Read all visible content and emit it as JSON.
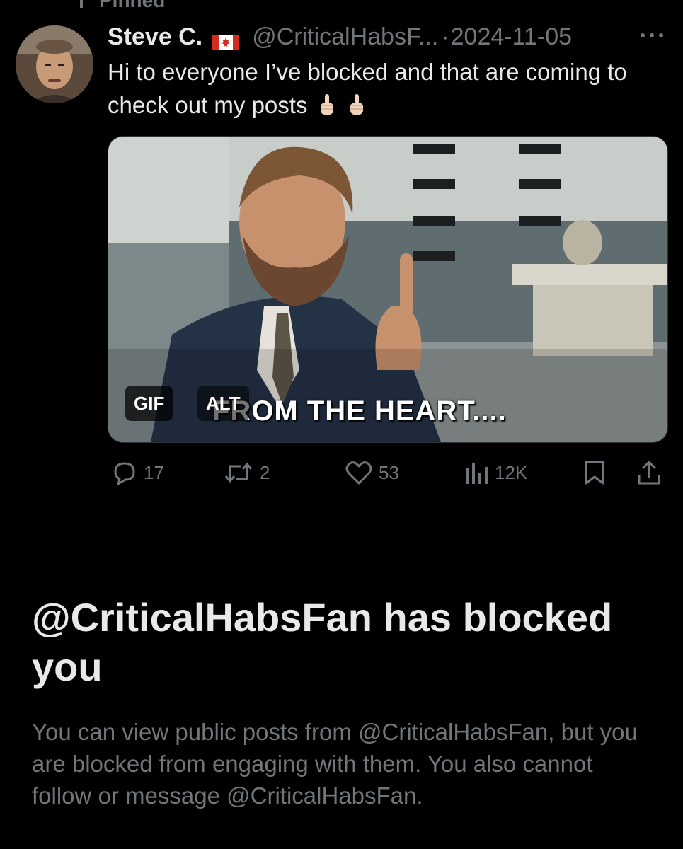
{
  "pinned": {
    "label": "Pinned"
  },
  "tweet": {
    "display_name": "Steve C.",
    "flag_icon": "canada-flag",
    "handle": "@CriticalHabsF...",
    "separator": "·",
    "date": "2024-11-05",
    "text": "Hi to everyone I’ve blocked and that are coming to check out my posts",
    "text_emojis": [
      "👆🏻",
      "👆🏻"
    ],
    "media": {
      "type": "GIF",
      "caption": "FROM THE HEART....",
      "gif_badge": "GIF",
      "alt_badge": "ALT"
    },
    "stats": {
      "replies": "17",
      "reposts": "2",
      "likes": "53",
      "views": "12K"
    },
    "icons": {
      "reply": "reply-icon",
      "repost": "repost-icon",
      "like": "heart-icon",
      "views": "views-icon",
      "bookmark": "bookmark-icon",
      "share": "share-icon",
      "more": "more-icon"
    }
  },
  "blocked_notice": {
    "title": "@CriticalHabsFan has blocked you",
    "description": "You can view public posts from @CriticalHabsFan, but you are blocked from engaging with them. You also cannot follow or message @CriticalHabsFan."
  },
  "colors": {
    "background": "#000000",
    "primary_text": "#e7e9ea",
    "secondary_text": "#71767b",
    "divider": "#2f3336"
  }
}
